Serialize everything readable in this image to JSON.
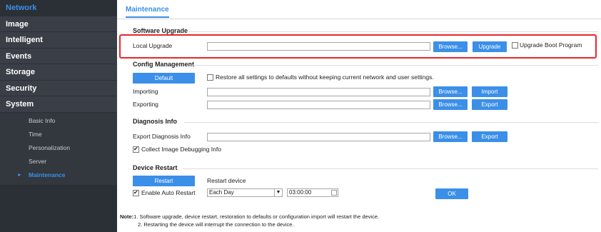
{
  "sidebar": {
    "items": [
      {
        "label": "Network"
      },
      {
        "label": "Image"
      },
      {
        "label": "Intelligent"
      },
      {
        "label": "Events"
      },
      {
        "label": "Storage"
      },
      {
        "label": "Security"
      },
      {
        "label": "System"
      }
    ],
    "system_sub": [
      {
        "label": "Basic Info"
      },
      {
        "label": "Time"
      },
      {
        "label": "Personalization"
      },
      {
        "label": "Server"
      },
      {
        "label": "Maintenance"
      }
    ]
  },
  "tab": {
    "label": "Maintenance"
  },
  "software_upgrade": {
    "title": "Software Upgrade",
    "local_upgrade_label": "Local Upgrade",
    "browse_label": "Browse...",
    "upgrade_label": "Upgrade",
    "boot_program_label": "Upgrade Boot Program"
  },
  "config": {
    "title": "Config Management",
    "default_label": "Default",
    "restore_label": "Restore all settings to defaults without keeping current network and user settings.",
    "importing_label": "Importing",
    "exporting_label": "Exporting",
    "browse_label": "Browse...",
    "import_label": "Import",
    "export_label": "Export"
  },
  "diagnosis": {
    "title": "Diagnosis Info",
    "export_label": "Export Diagnosis Info",
    "browse_label": "Browse...",
    "export_button": "Export",
    "collect_label": "Collect Image Debugging Info"
  },
  "restart": {
    "title": "Device Restart",
    "restart_button": "Restart",
    "restart_device_label": "Restart device",
    "auto_restart_label": "Enable Auto Restart",
    "frequency": "Each Day",
    "time": "03:00:00",
    "ok_label": "OK"
  },
  "note": {
    "prefix": "Note:",
    "line1": "1. Software upgrade, device restart, restoration to defaults or configuration import will restart the device.",
    "line2": "2. Restarting the device will interrupt the connection to the device."
  },
  "colors": {
    "accent": "#3b8fe8",
    "sidebar_bg": "#2b2f36",
    "highlight": "#e8262b"
  }
}
